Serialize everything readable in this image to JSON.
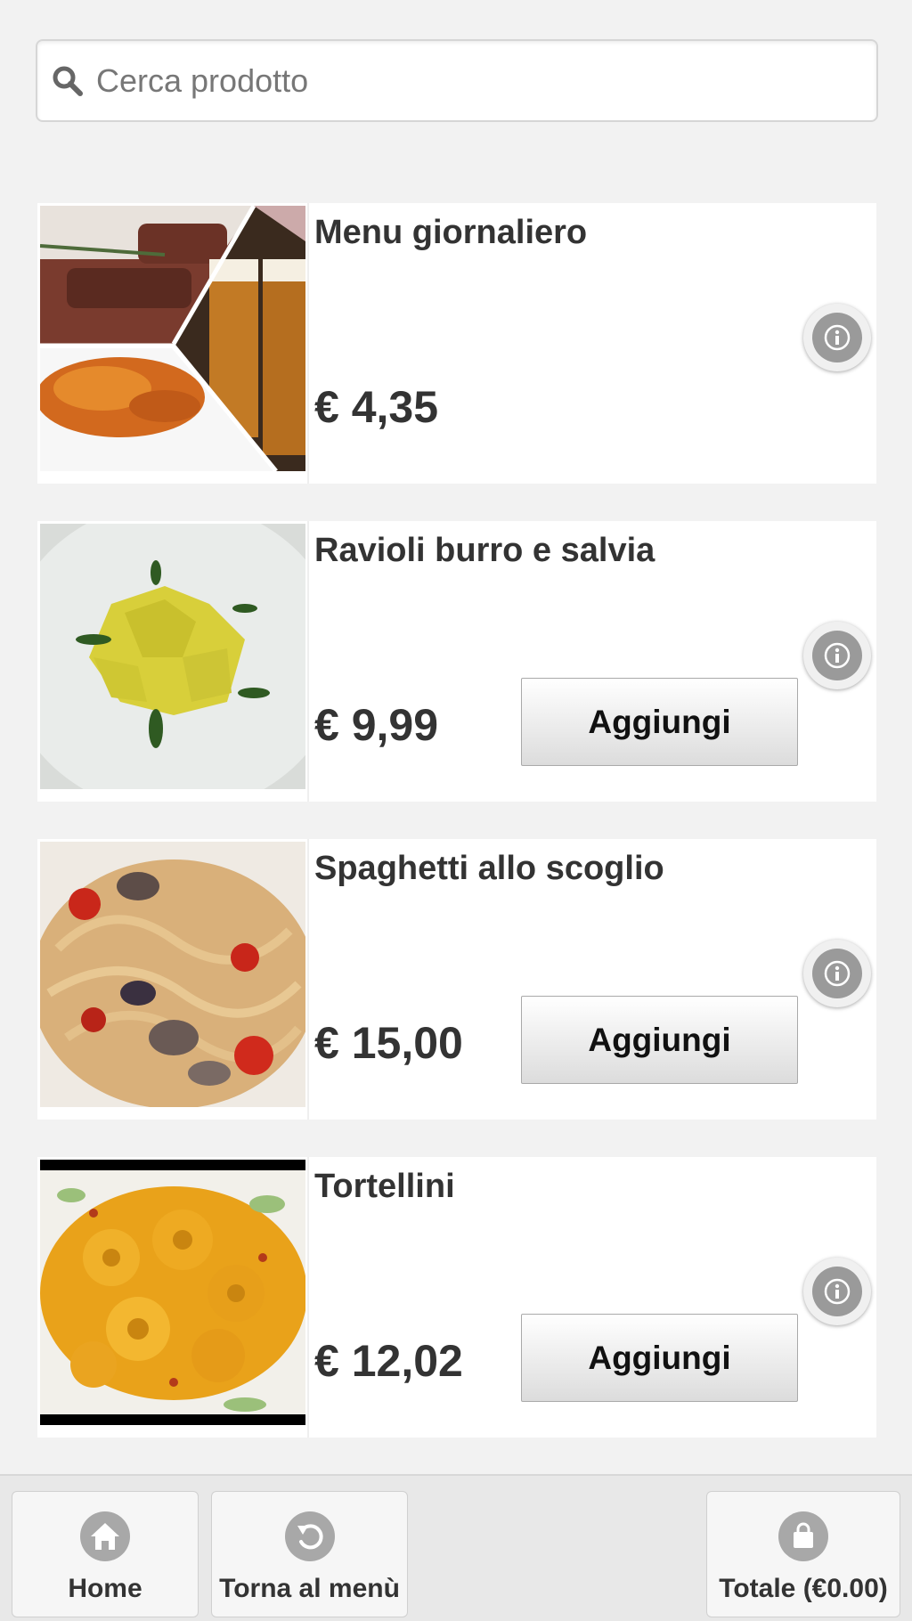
{
  "search": {
    "placeholder": "Cerca prodotto"
  },
  "products": [
    {
      "name": "Menu giornaliero",
      "price": "€ 4,35",
      "image_icon": "daily-menu-photo"
    },
    {
      "name": "Ravioli burro e salvia",
      "price": "€ 9,99",
      "add_label": "Aggiungi",
      "image_icon": "ravioli-photo"
    },
    {
      "name": "Spaghetti allo scoglio",
      "price": "€ 15,00",
      "add_label": "Aggiungi",
      "image_icon": "spaghetti-photo"
    },
    {
      "name": "Tortellini",
      "price": "€ 12,02",
      "add_label": "Aggiungi",
      "image_icon": "tortellini-photo"
    }
  ],
  "bottom_bar": {
    "home_label": "Home",
    "back_label": "Torna al menù",
    "total_label": "Totale (€0.00)"
  },
  "colors": {
    "background": "#f2f2f2",
    "card": "#ffffff",
    "icon_gray": "#a8a8a8",
    "text": "#333333"
  }
}
